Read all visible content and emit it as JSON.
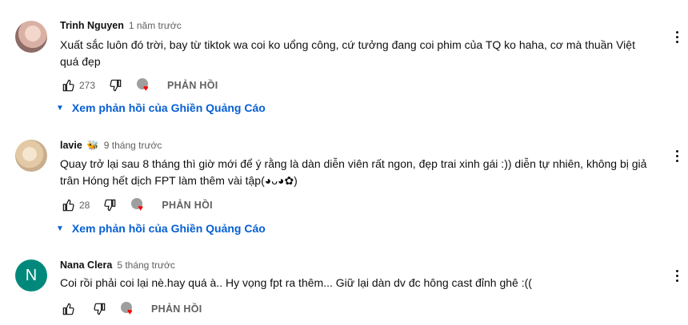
{
  "comments": [
    {
      "author": "Trinh Nguyen",
      "badge": "",
      "time": "1 năm trước",
      "text": "Xuất sắc luôn đó trời, bay từ tiktok wa coi ko uổng công, cứ tưởng đang coi phim của TQ ko haha, cơ mà thuần Việt quá đẹp",
      "likes": "273",
      "reply_label": "PHẢN HỒI",
      "view_replies": "Xem phản hồi của Ghiền Quảng Cáo",
      "avatar_letter": ""
    },
    {
      "author": "lavie",
      "badge": "🐝",
      "time": "9 tháng trước",
      "text": "Quay trở lại sau 8 tháng thì giờ mới để ý rằng là dàn diễn viên rất ngon, đẹp trai xinh gái :)) diễn tự nhiên, không bị giả trân Hóng hết dịch FPT làm thêm vài tập(◕ᴗ◕✿)",
      "likes": "28",
      "reply_label": "PHẢN HỒI",
      "view_replies": "Xem phản hồi của Ghiền Quảng Cáo",
      "avatar_letter": ""
    },
    {
      "author": "Nana Clera",
      "badge": "",
      "time": "5 tháng trước",
      "text": "Coi rồi phải coi lại nè.hay quá à.. Hy vọng fpt ra thêm... Giữ lại dàn dv đc hông cast đỉnh ghê :((",
      "likes": "",
      "reply_label": "PHẢN HỒI",
      "view_replies": "",
      "avatar_letter": "N"
    }
  ],
  "icons": {
    "like": "thumb-up-icon",
    "dislike": "thumb-down-icon",
    "creator_heart": "creator-heart-icon",
    "menu": "more-vert-icon",
    "caret": "caret-down-icon"
  },
  "colors": {
    "link": "#065fd4",
    "heart": "#ff0000",
    "avatar_N": "#00897b"
  }
}
